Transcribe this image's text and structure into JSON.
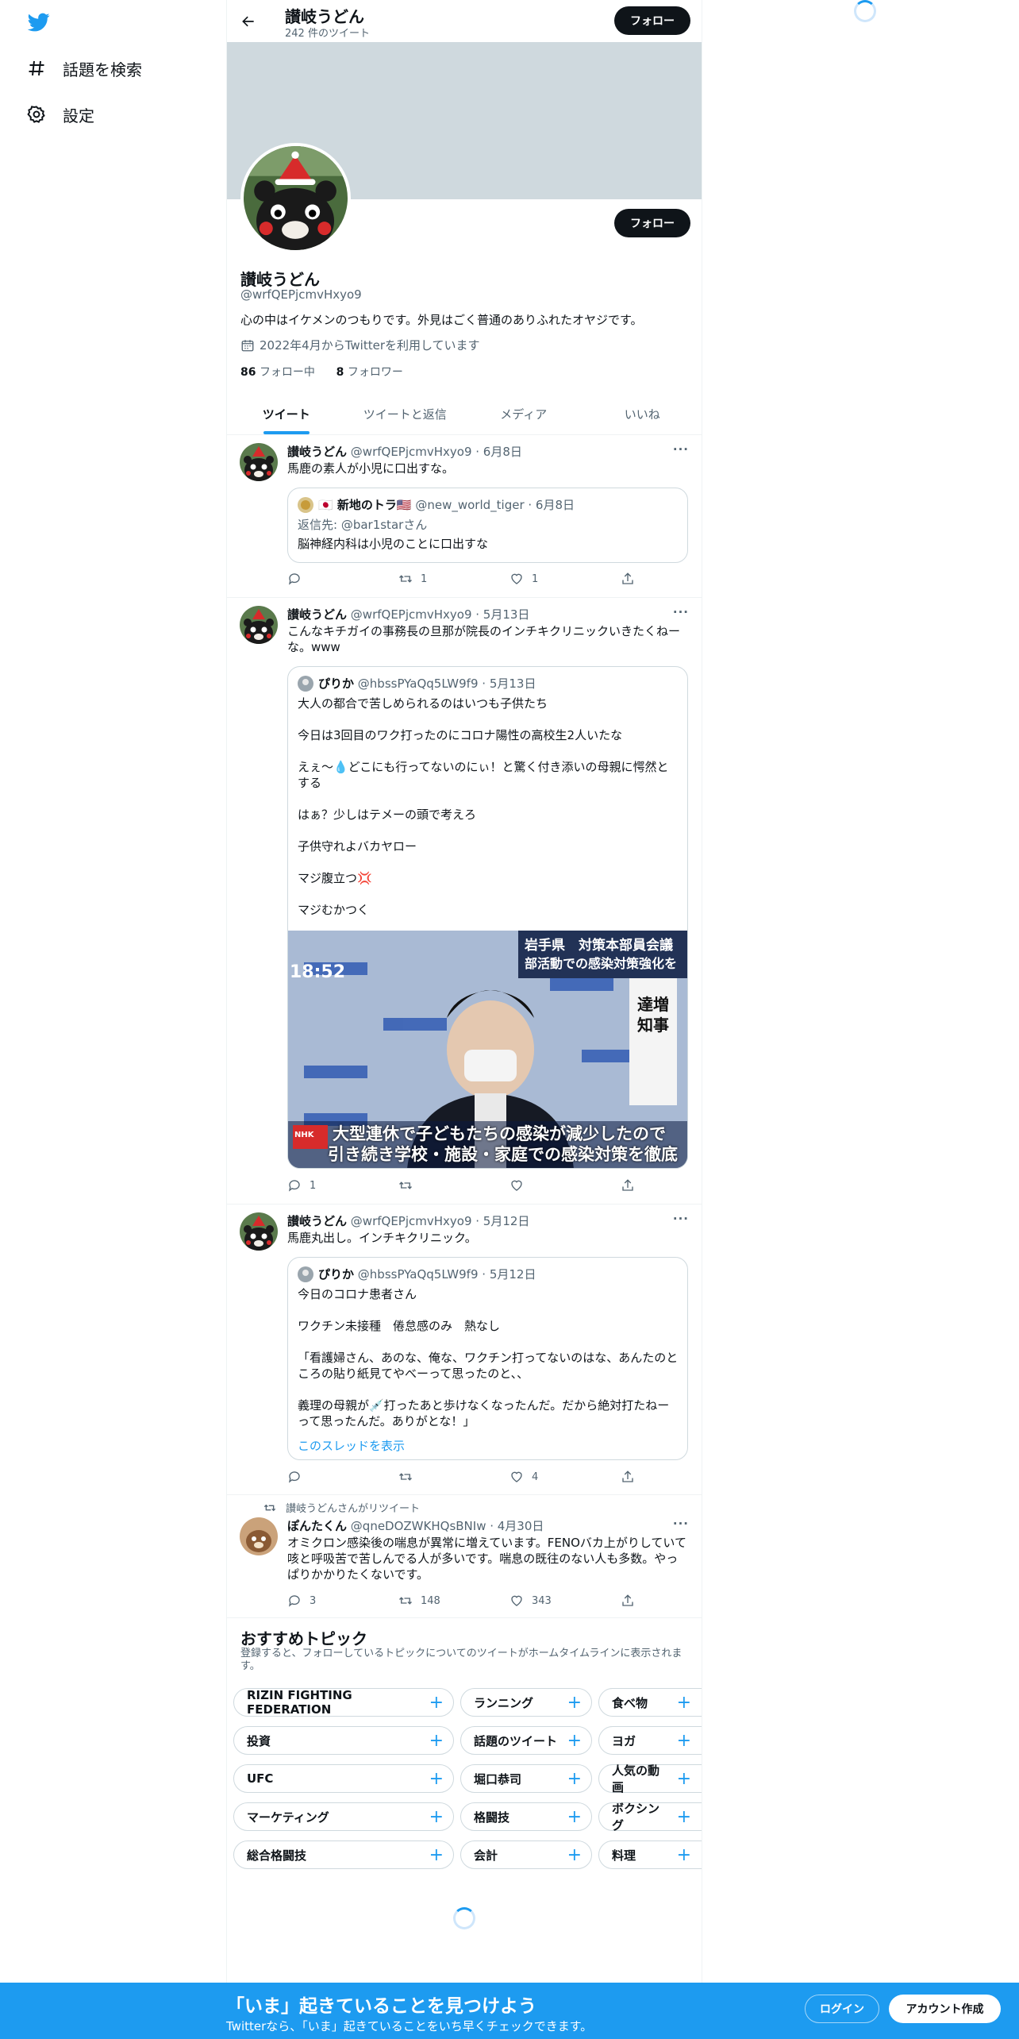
{
  "nav": {
    "explore": "話題を検索",
    "settings": "設定"
  },
  "header": {
    "name": "讃岐うどん",
    "tweet_count": "242 件のツイート",
    "follow_label": "フォロー"
  },
  "profile": {
    "name": "讃岐うどん",
    "handle": "@wrfQEPjcmvHxyo9",
    "bio": "心の中はイケメンのつもりです。外見はごく普通のありふれたオヤジです。",
    "joined": "2022年4月からTwitterを利用しています",
    "following_count": "86",
    "following_label": "フォロー中",
    "followers_count": "8",
    "followers_label": "フォロワー",
    "follow_label": "フォロー"
  },
  "tabs": [
    "ツイート",
    "ツイートと返信",
    "メディア",
    "いいね"
  ],
  "tweets": [
    {
      "name": "讃岐うどん",
      "meta": "@wrfQEPjcmvHxyo9 · 6月8日",
      "text": "馬鹿の素人が小児に口出すな。",
      "quote": {
        "name": "🇯🇵 新地のトラ🇺🇸",
        "meta": "@new_world_tiger · 6月8日",
        "reply_to": "返信先: @bar1starさん",
        "text": "脳神経内科は小児のことに口出すな"
      },
      "replies": "",
      "retweets": "1",
      "likes": "1"
    },
    {
      "name": "讃岐うどん",
      "meta": "@wrfQEPjcmvHxyo9 · 5月13日",
      "text": "こんなキチガイの事務長の旦那が院長のインチキクリニックいきたくねーな。www",
      "quote": {
        "name": "ぴりか",
        "meta": "@hbssPYaQq5LW9f9 · 5月13日",
        "text": "大人の都合で苦しめられるのはいつも子供たち\n\n今日は3回目のワク打ったのにコロナ陽性の高校生2人いたな\n\nえぇ〜💧どこにも行ってないのにぃ！と驚く付き添いの母親に愕然とする\n\nはぁ？少しはテメーの頭で考えろ\n\n子供守れよバカヤロー\n\nマジ腹立つ💢\n\nマジむかつく",
        "image_caption_1": "岩手県　対策本部員会議",
        "image_caption_2": "部活動での感染対策強化を",
        "image_caption_3": "大型連休で子どもたちの感染が減少したので",
        "image_caption_4": "引き続き学校・施設・家庭での感染対策を徹底",
        "image_clock": "18:52",
        "image_side": "達増知事",
        "image_logo": "NHK"
      },
      "replies": "1",
      "retweets": "",
      "likes": ""
    },
    {
      "name": "讃岐うどん",
      "meta": "@wrfQEPjcmvHxyo9 · 5月12日",
      "text": "馬鹿丸出し。インチキクリニック。",
      "quote": {
        "name": "ぴりか",
        "meta": "@hbssPYaQq5LW9f9 · 5月12日",
        "text": "今日のコロナ患者さん\n\nワクチン未接種　倦怠感のみ　熱なし\n\n「看護婦さん、あのな、俺な、ワクチン打ってないのはな、あんたのところの貼り紙見てやべーって思ったのと、、\n\n義理の母親が💉打ったあと歩けなくなったんだ。だから絶対打たねーって思ったんだ。ありがとな！」",
        "thread_link": "このスレッドを表示"
      },
      "replies": "",
      "retweets": "",
      "likes": "4"
    },
    {
      "retweet_note": "讃岐うどんさんがリツイート",
      "name": "ぽんたくん",
      "meta": "@qneDOZWKHQsBNIw · 4月30日",
      "text": "オミクロン感染後の喘息が異常に増えています。FENOバカ上がりしていて咳と呼吸苦で苦しんでる人が多いです。喘息の既往のない人も多数。やっぱりかかりたくないです。",
      "replies": "3",
      "retweets": "148",
      "likes": "343"
    }
  ],
  "topics": {
    "title": "おすすめトピック",
    "subtitle": "登録すると、フォローしているトピックについてのツイートがホームタイムラインに表示されます。",
    "rows": [
      [
        "RIZIN FIGHTING FEDERATION",
        "ランニング",
        "食べ物"
      ],
      [
        "投資",
        "話題のツイート",
        "ヨガ"
      ],
      [
        "UFC",
        "堀口恭司",
        "人気の動画"
      ],
      [
        "マーケティング",
        "格闘技",
        "ボクシング"
      ],
      [
        "総合格闘技",
        "会計",
        "料理"
      ]
    ]
  },
  "bottom_bar": {
    "title": "「いま」起きていることを見つけよう",
    "subtitle": "Twitterなら、「いま」起きていることをいち早くチェックできます。",
    "login": "ログイン",
    "signup": "アカウント作成"
  },
  "colors": {
    "accent": "#1d9bf0",
    "text": "#0f1419",
    "muted": "#536471"
  }
}
